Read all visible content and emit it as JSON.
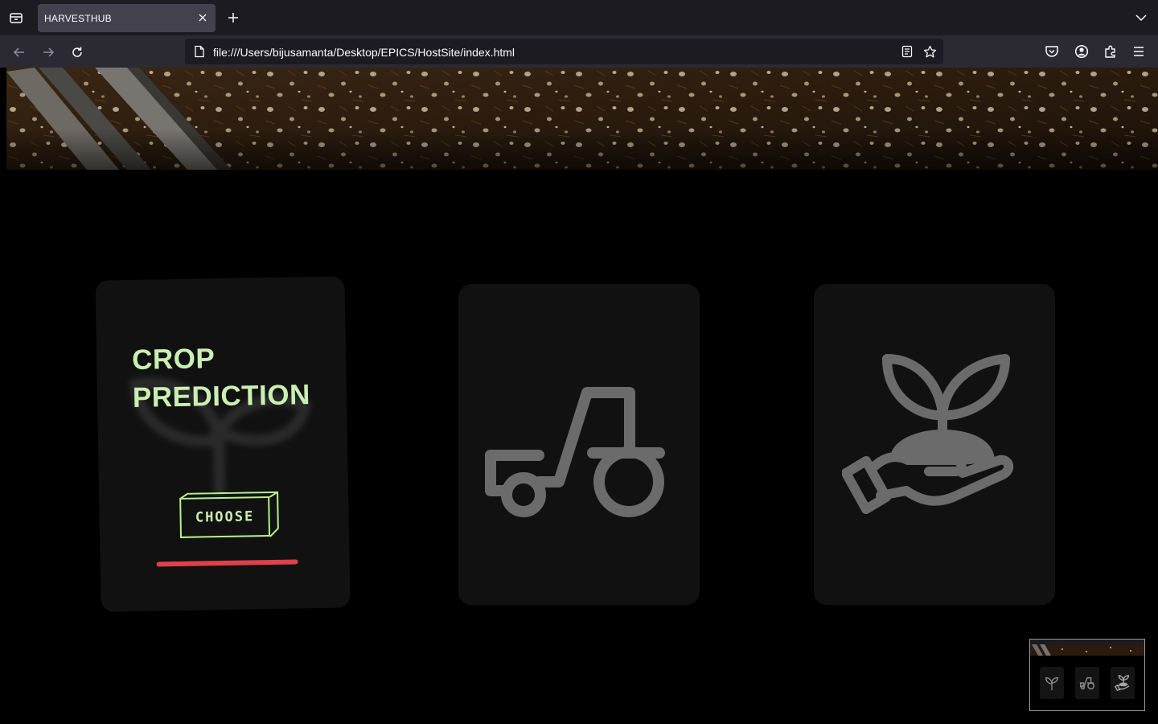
{
  "browser": {
    "tab": {
      "title": "HARVESTHUB"
    },
    "url": "file:///Users/bijusamanta/Desktop/EPICS/HostSite/index.html"
  },
  "page": {
    "cards": [
      {
        "title_line1": "CROP",
        "title_line2": "PREDICTION",
        "button_label": "CHOOSE",
        "icon": "sprout-icon"
      },
      {
        "icon": "tractor-icon"
      },
      {
        "icon": "plant-in-hand-icon"
      }
    ]
  },
  "colors": {
    "page_background": "#000000",
    "card_background": "#111111",
    "accent_green": "#c9efb2",
    "underline_red": "#e0404a",
    "icon_gray": "#6b6b6b",
    "tab_bar": "#1c1b22",
    "toolbar": "#2b2a33"
  }
}
